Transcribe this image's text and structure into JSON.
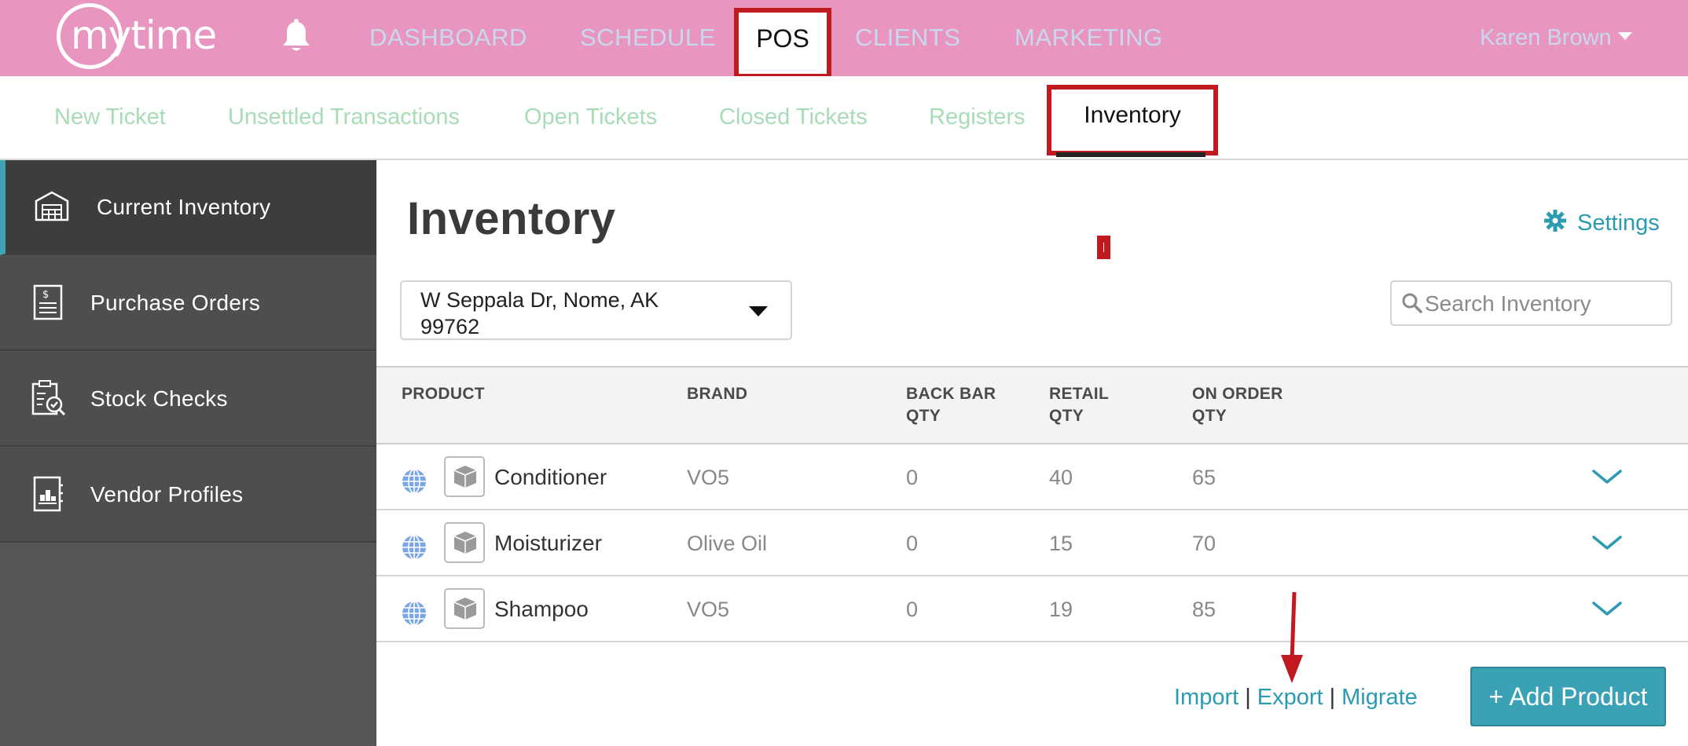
{
  "app": {
    "logo_text": "mytime"
  },
  "topnav": {
    "items": [
      {
        "label": "DASHBOARD"
      },
      {
        "label": "SCHEDULE"
      },
      {
        "label": "POS",
        "active": true
      },
      {
        "label": "CLIENTS"
      },
      {
        "label": "MARKETING"
      }
    ],
    "user": "Karen Brown",
    "icons": {
      "notifications": "bell-icon",
      "user_menu": "caret-down-icon"
    },
    "colors": {
      "bar": "#e896bf",
      "highlight": "#c0191f"
    }
  },
  "subnav": {
    "items": [
      {
        "label": "New Ticket"
      },
      {
        "label": "Unsettled Transactions"
      },
      {
        "label": "Open Tickets"
      },
      {
        "label": "Closed Tickets"
      },
      {
        "label": "Registers"
      },
      {
        "label": "Inventory",
        "active": true
      }
    ]
  },
  "sidebar": {
    "items": [
      {
        "label": "Current Inventory",
        "icon": "warehouse-icon",
        "active": true
      },
      {
        "label": "Purchase Orders",
        "icon": "invoice-icon"
      },
      {
        "label": "Stock Checks",
        "icon": "clipboard-check-icon"
      },
      {
        "label": "Vendor Profiles",
        "icon": "vendor-book-icon"
      }
    ],
    "colors": {
      "accent": "#3fa3b3"
    }
  },
  "main": {
    "title": "Inventory",
    "settings_label": "Settings",
    "location": "W Seppala Dr, Nome, AK 99762",
    "search": {
      "placeholder": "Search Inventory",
      "value": ""
    },
    "table": {
      "headers": {
        "product": "PRODUCT",
        "brand": "BRAND",
        "back_bar_qty": "BACK BAR QTY",
        "retail_qty": "RETAIL QTY",
        "on_order_qty": "ON ORDER QTY"
      },
      "rows": [
        {
          "product": "Conditioner",
          "brand": "VO5",
          "back_bar_qty": "0",
          "retail_qty": "40",
          "on_order_qty": "65"
        },
        {
          "product": "Moisturizer",
          "brand": "Olive Oil",
          "back_bar_qty": "0",
          "retail_qty": "15",
          "on_order_qty": "70"
        },
        {
          "product": "Shampoo",
          "brand": "VO5",
          "back_bar_qty": "0",
          "retail_qty": "19",
          "on_order_qty": "85"
        }
      ]
    },
    "footer": {
      "import_label": "Import",
      "export_label": "Export",
      "migrate_label": "Migrate",
      "separator": "|",
      "add_product_label": "+ Add Product"
    },
    "colors": {
      "link": "#2a9bb0",
      "button": "#3aa2b4"
    }
  }
}
